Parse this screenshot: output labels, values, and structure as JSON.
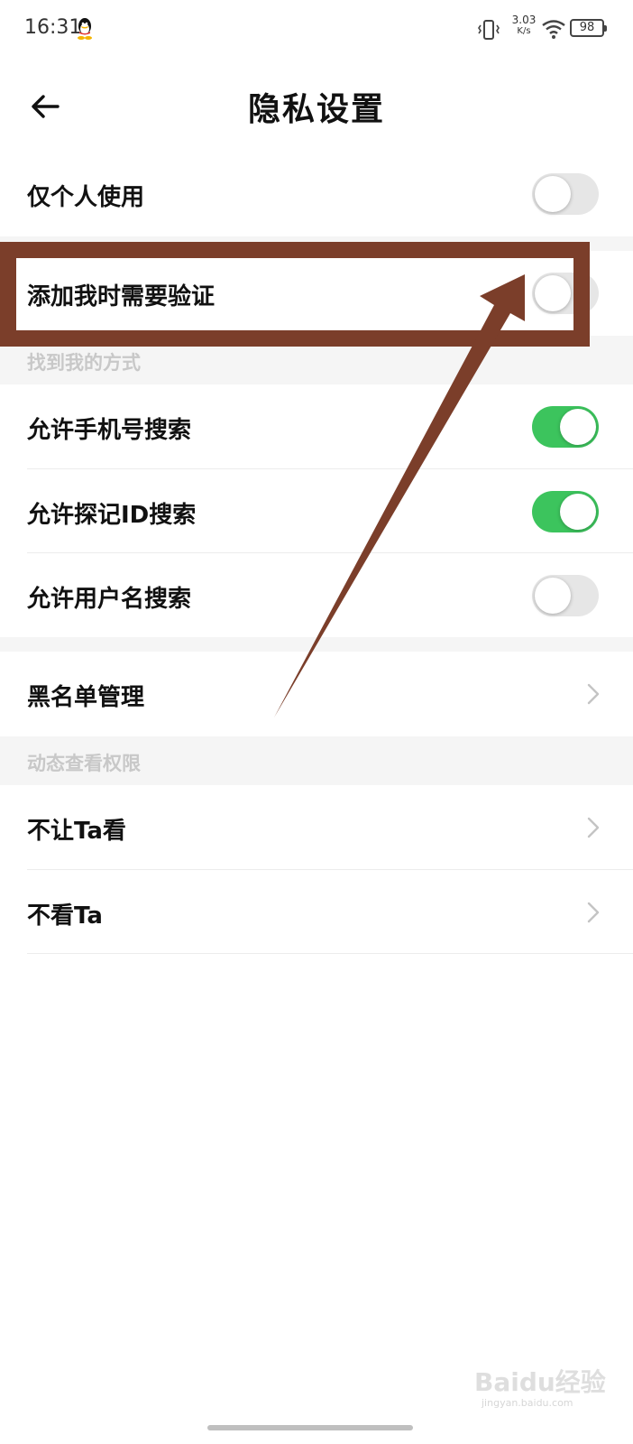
{
  "status_bar": {
    "time": "16:31",
    "net_speed_value": "3.03",
    "net_speed_unit": "K/s",
    "battery": "98",
    "icons": [
      "qq-icon",
      "vibrate-icon",
      "wifi-icon",
      "battery-icon"
    ]
  },
  "header": {
    "title": "隐私设置",
    "back_icon": "arrow-left-icon"
  },
  "settings": {
    "personal_only": {
      "label": "仅个人使用",
      "toggle_on": false
    },
    "verify_add": {
      "label": "添加我时需要验证",
      "toggle_on": false
    },
    "find_me_section": "找到我的方式",
    "phone_search": {
      "label": "允许手机号搜索",
      "toggle_on": true
    },
    "id_search": {
      "label": "允许探记ID搜索",
      "toggle_on": true
    },
    "username_search": {
      "label": "允许用户名搜索",
      "toggle_on": false
    },
    "blacklist": {
      "label": "黑名单管理"
    },
    "moments_section": "动态查看权限",
    "hide_from": {
      "label": "不让Ta看"
    },
    "not_see": {
      "label": "不看Ta"
    }
  },
  "colors": {
    "toggle_on": "#3cc45d",
    "toggle_off": "#e6e6e6",
    "annotation": "#7b3e2a",
    "section_text": "#c8c8c8"
  },
  "watermark": {
    "main": "Baidu经验",
    "sub": "jingyan.baidu.com"
  }
}
